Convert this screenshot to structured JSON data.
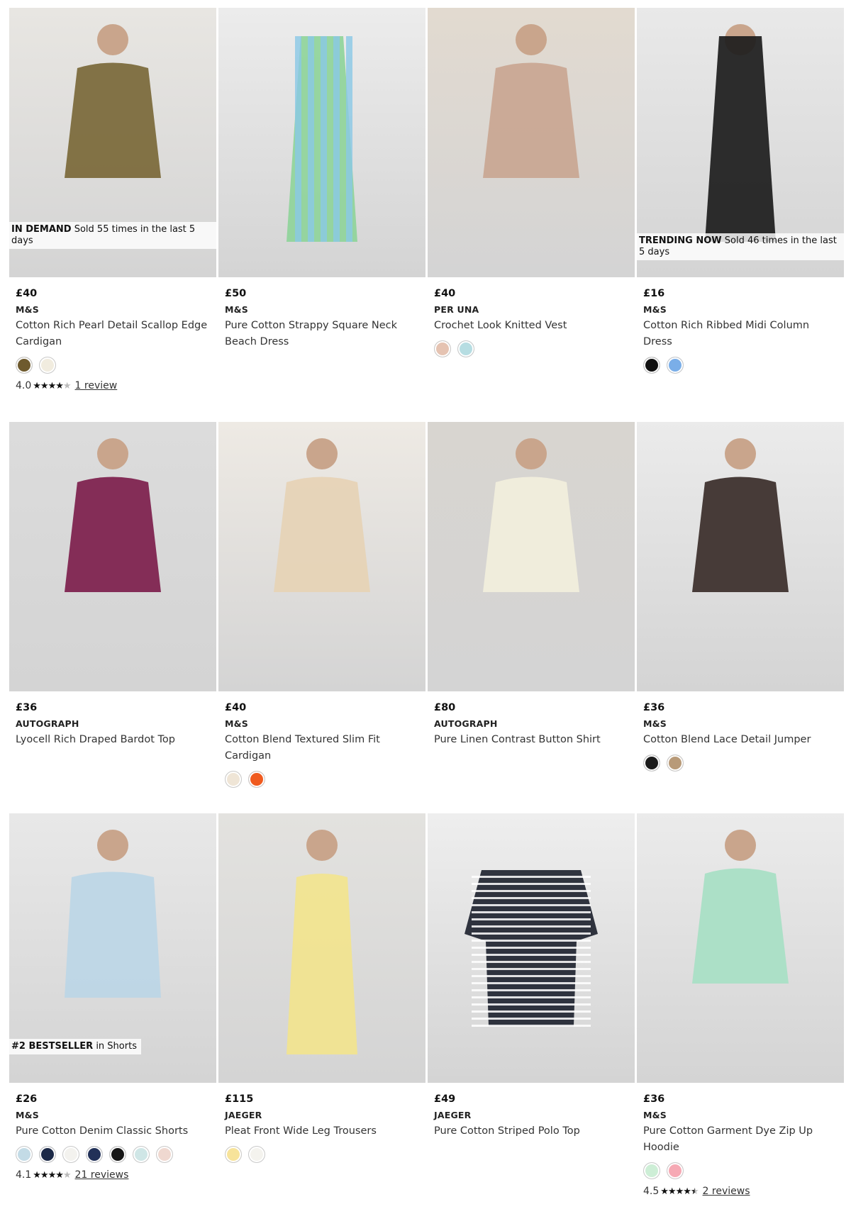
{
  "products": [
    {
      "badge_strong": "IN DEMAND",
      "badge_text": " Sold 55 times in the last 5 days",
      "price": "£40",
      "brand": "M&S",
      "name": "Cotton Rich Pearl Detail Scallop Edge Cardigan",
      "swatches": [
        "#6e5a2e",
        "#f1ecdf"
      ],
      "rating": "4.0",
      "stars": 4,
      "reviews": "1 review",
      "photo_bg": "#e8e6e2",
      "figure_color": "#7a6838",
      "figure_icon": "cardigan"
    },
    {
      "badge_strong": "",
      "badge_text": "",
      "price": "£50",
      "brand": "M&S",
      "name": "Pure Cotton Strappy Square Neck Beach Dress",
      "swatches": [],
      "rating": "",
      "stars": 0,
      "reviews": "",
      "photo_bg": "#ececec",
      "figure_color": "#8fd49a",
      "figure_icon": "dress"
    },
    {
      "badge_strong": "",
      "badge_text": "",
      "price": "£40",
      "brand": "PER UNA",
      "name": "Crochet Look Knitted Vest",
      "swatches": [
        "#e5c3b2",
        "#b6dde2"
      ],
      "rating": "",
      "stars": 0,
      "reviews": "",
      "photo_bg": "#e2dad0",
      "figure_color": "#c9a691",
      "figure_icon": "vest"
    },
    {
      "badge_strong": "TRENDING NOW",
      "badge_text": " Sold 46 times in the last 5 days",
      "price": "£16",
      "brand": "M&S",
      "name": "Cotton Rich Ribbed Midi Column Dress",
      "swatches": [
        "#111111",
        "#7aaee8"
      ],
      "rating": "",
      "stars": 0,
      "reviews": "",
      "photo_bg": "#e9e9e9",
      "figure_color": "#1c1c1c",
      "figure_icon": "column-dress"
    },
    {
      "badge_strong": "",
      "badge_text": "",
      "price": "£36",
      "brand": "AUTOGRAPH",
      "name": "Lyocell Rich Draped Bardot Top",
      "swatches": [],
      "rating": "",
      "stars": 0,
      "reviews": "",
      "photo_bg": "#dcdcdc",
      "figure_color": "#7d1e4c",
      "figure_icon": "bardot-top"
    },
    {
      "badge_strong": "",
      "badge_text": "",
      "price": "£40",
      "brand": "M&S",
      "name": "Cotton Blend Textured Slim Fit Cardigan",
      "swatches": [
        "#efe5d6",
        "#f05a1e"
      ],
      "rating": "",
      "stars": 0,
      "reviews": "",
      "photo_bg": "#eeeae4",
      "figure_color": "#e6d3b5",
      "figure_icon": "cardigan"
    },
    {
      "badge_strong": "",
      "badge_text": "",
      "price": "£80",
      "brand": "AUTOGRAPH",
      "name": "Pure Linen Contrast Button Shirt",
      "swatches": [],
      "rating": "",
      "stars": 0,
      "reviews": "",
      "photo_bg": "#d8d5d0",
      "figure_color": "#f2efdc",
      "figure_icon": "shirt"
    },
    {
      "badge_strong": "",
      "badge_text": "",
      "price": "£36",
      "brand": "M&S",
      "name": "Cotton Blend Lace Detail Jumper",
      "swatches": [
        "#1b1b1b",
        "#b89a78"
      ],
      "rating": "",
      "stars": 0,
      "reviews": "",
      "photo_bg": "#ebebeb",
      "figure_color": "#3a2d29",
      "figure_icon": "jumper"
    },
    {
      "badge_strong": "#2 BESTSELLER",
      "badge_text": " in Shorts",
      "price": "£26",
      "brand": "M&S",
      "name": "Pure Cotton Denim Classic Shorts",
      "swatches": [
        "#c3dbe6",
        "#1c2947",
        "#f3f2ee",
        "#223158",
        "#161616",
        "#cfe6e6",
        "#efd8d0"
      ],
      "rating": "4.1",
      "stars": 4,
      "reviews": "21 reviews",
      "photo_bg": "#e8e8e8",
      "figure_color": "#bcd6e6",
      "figure_icon": "shorts"
    },
    {
      "badge_strong": "",
      "badge_text": "",
      "price": "£115",
      "brand": "JAEGER",
      "name": "Pleat Front Wide Leg Trousers",
      "swatches": [
        "#f7e39a",
        "#f4f3ee"
      ],
      "rating": "",
      "stars": 0,
      "reviews": "",
      "photo_bg": "#e3e2df",
      "figure_color": "#f2e48e",
      "figure_icon": "trousers"
    },
    {
      "badge_strong": "",
      "badge_text": "",
      "price": "£49",
      "brand": "JAEGER",
      "name": "Pure Cotton Striped Polo Top",
      "swatches": [],
      "rating": "",
      "stars": 0,
      "reviews": "",
      "photo_bg": "#eeeeee",
      "figure_color": "#1f2430",
      "figure_icon": "polo"
    },
    {
      "badge_strong": "",
      "badge_text": "",
      "price": "£36",
      "brand": "M&S",
      "name": "Pure Cotton Garment Dye Zip Up Hoodie",
      "swatches": [
        "#cdeed6",
        "#f6a9b4"
      ],
      "rating": "4.5",
      "stars": 4.5,
      "reviews": "2 reviews",
      "photo_bg": "#ebebeb",
      "figure_color": "#a7e0c4",
      "figure_icon": "hoodie"
    }
  ]
}
